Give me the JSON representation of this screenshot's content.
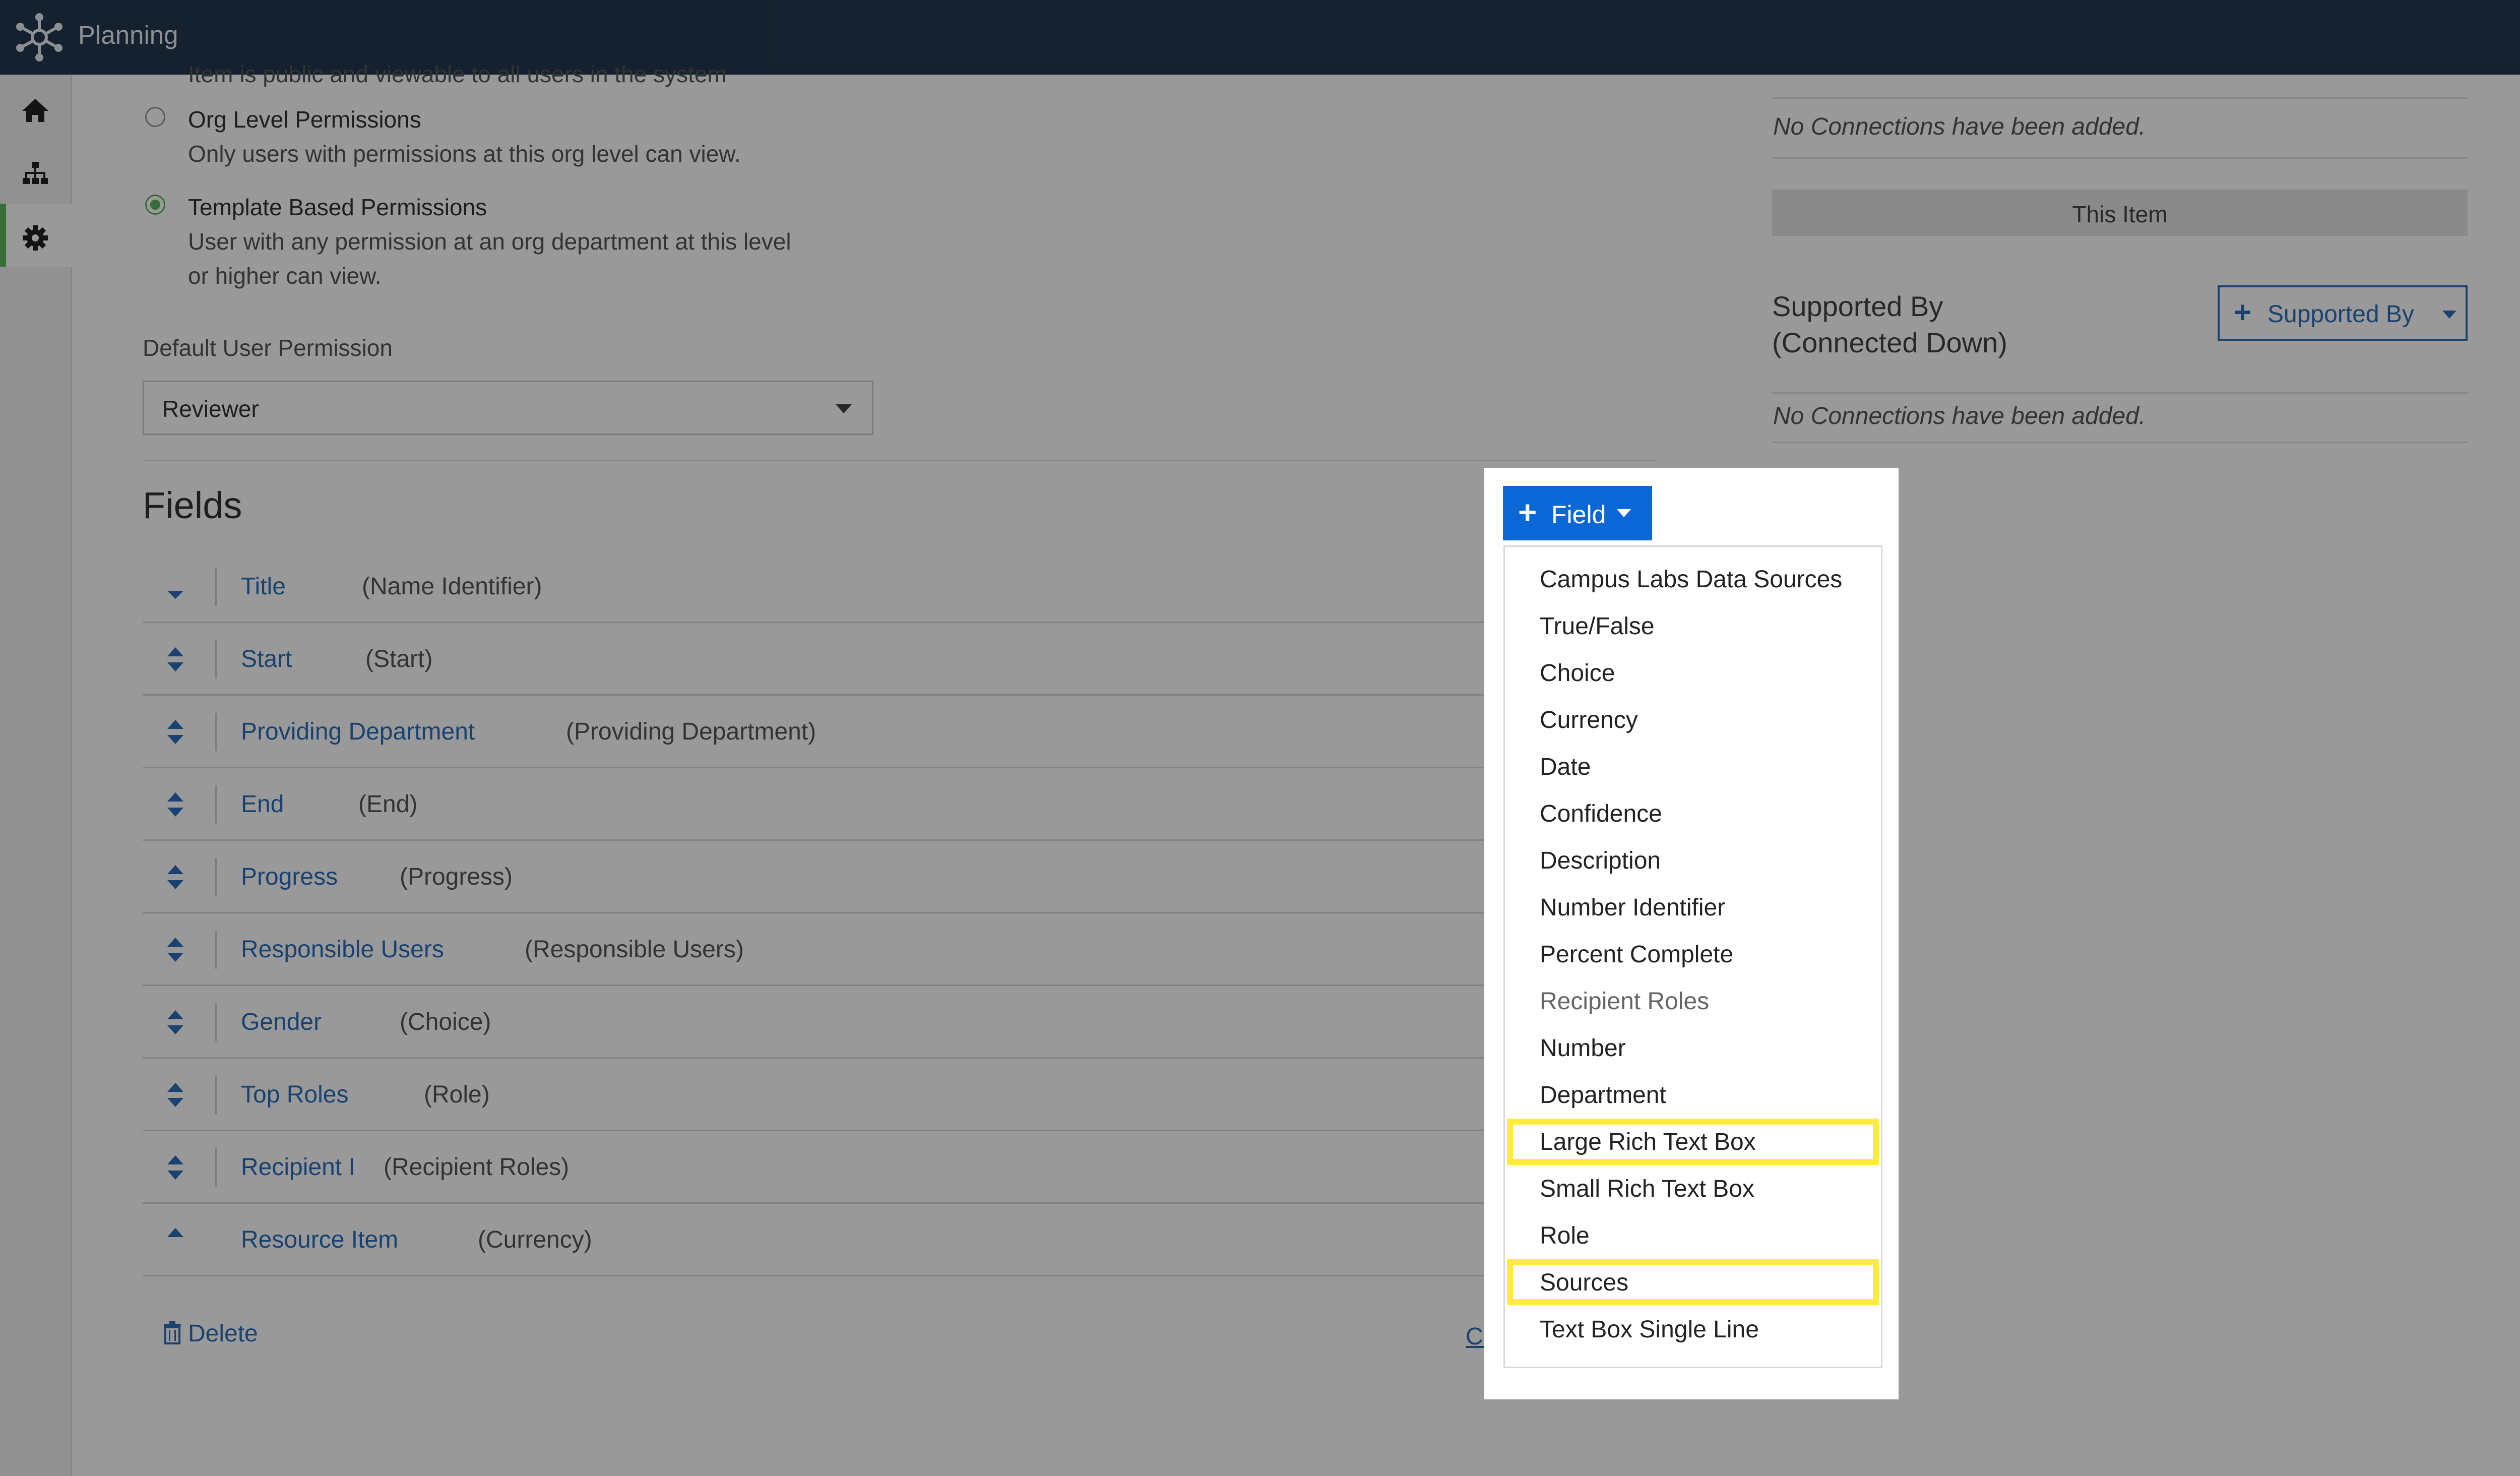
{
  "app": {
    "title": "Planning",
    "logo_icon": "network-hub-icon"
  },
  "sidebar": {
    "items": [
      {
        "icon": "home-icon",
        "active": false
      },
      {
        "icon": "org-chart-icon",
        "active": false
      },
      {
        "icon": "gear-icon",
        "active": true
      }
    ],
    "active_color": "#5cb85c"
  },
  "permissions": {
    "truncated_text": "Item is public and viewable to all users in the system",
    "options": [
      {
        "label": "Org Level Permissions",
        "description": "Only users with permissions at this org level can view.",
        "selected": false
      },
      {
        "label": "Template Based Permissions",
        "description_line1": "User with any permission at an org department at this level",
        "description_line2": "or higher can view.",
        "selected": true
      }
    ]
  },
  "default_permission": {
    "label": "Default User Permission",
    "value": "Reviewer"
  },
  "fields": {
    "title": "Fields",
    "rows": [
      {
        "name": "Title",
        "type": "(Name Identifier)",
        "handle": "down"
      },
      {
        "name": "Start",
        "type": "(Start)",
        "handle": "up-down"
      },
      {
        "name": "Providing Department",
        "type": "(Providing Department)",
        "handle": "up-down"
      },
      {
        "name": "End",
        "type": "(End)",
        "handle": "up-down"
      },
      {
        "name": "Progress",
        "type": "(Progress)",
        "handle": "up-down"
      },
      {
        "name": "Responsible Users",
        "type": "(Responsible Users)",
        "handle": "up-down"
      },
      {
        "name": "Gender",
        "type": "(Choice)",
        "handle": "up-down"
      },
      {
        "name": "Top Roles",
        "type": "(Role)",
        "handle": "up-down"
      },
      {
        "name": "Recipient I",
        "type": "(Recipient Roles)",
        "handle": "up-down"
      },
      {
        "name": "Resource Item",
        "type": "(Currency)",
        "handle": "up"
      }
    ],
    "delete_label": "Delete",
    "cancel_label": "Car"
  },
  "connections": {
    "empty_text": "No Connections have been added.",
    "this_item_label": "This Item",
    "supported_by_heading_line1": "Supported By",
    "supported_by_heading_line2": "(Connected Down)",
    "supported_by_button": "Supported By"
  },
  "field_dropdown": {
    "button_label": "Field",
    "items": [
      {
        "label": "Campus Labs Data Sources",
        "highlighted": false
      },
      {
        "label": "True/False",
        "highlighted": false
      },
      {
        "label": "Choice",
        "highlighted": false
      },
      {
        "label": "Currency",
        "highlighted": false
      },
      {
        "label": "Date",
        "highlighted": false
      },
      {
        "label": "Confidence",
        "highlighted": false
      },
      {
        "label": "Description",
        "highlighted": false
      },
      {
        "label": "Number Identifier",
        "highlighted": false
      },
      {
        "label": "Percent Complete",
        "highlighted": false
      },
      {
        "label": "Recipient Roles",
        "highlighted": false,
        "disabled": true
      },
      {
        "label": "Number",
        "highlighted": false
      },
      {
        "label": "Department",
        "highlighted": false
      },
      {
        "label": "Large Rich Text Box",
        "highlighted": true
      },
      {
        "label": "Small Rich Text Box",
        "highlighted": false
      },
      {
        "label": "Role",
        "highlighted": false
      },
      {
        "label": "Sources",
        "highlighted": true
      },
      {
        "label": "Text Box Single Line",
        "highlighted": false
      }
    ],
    "highlight_color": "#ffeb3b",
    "button_color": "#0b66d6"
  }
}
